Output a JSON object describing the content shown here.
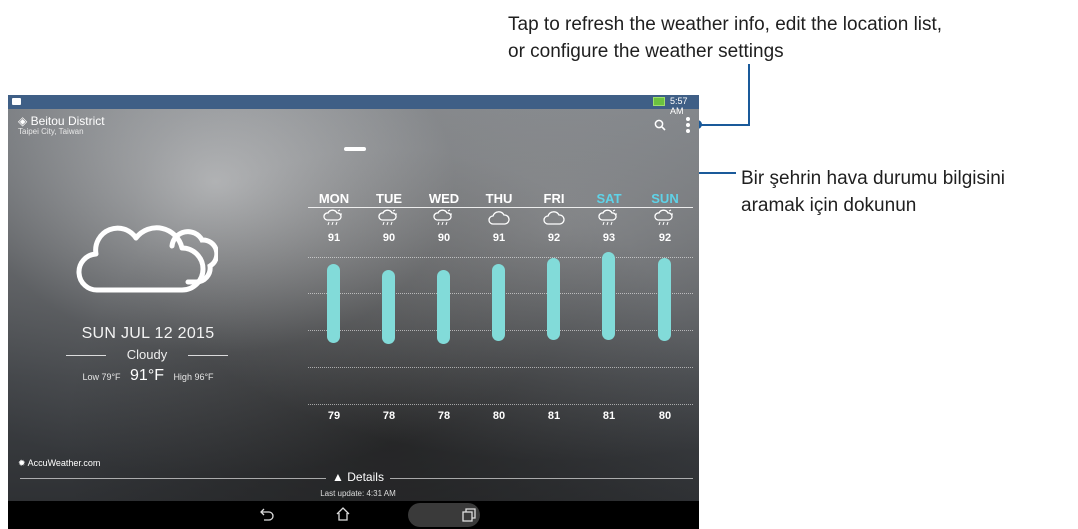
{
  "callouts": {
    "top_line1": "Tap to refresh the weather info, edit the location list,",
    "top_line2": "or configure the weather settings",
    "right_line1": "Bir şehrin hava durumu bilgisini",
    "right_line2": "aramak için dokunun"
  },
  "status_bar": {
    "time": "5:57 AM",
    "battery_icon": "battery-charging-icon"
  },
  "location": {
    "name": "Beitou District",
    "sub": "Taipei City, Taiwan",
    "icon": "location-icon"
  },
  "toolbar": {
    "search_icon": "search-icon",
    "menu_icon": "more-vert-icon"
  },
  "current": {
    "date": "SUN JUL 12 2015",
    "condition": "Cloudy",
    "low": "Low 79°F",
    "temp": "91°F",
    "high": "High 96°F",
    "icon": "cloud-icon"
  },
  "forecast": [
    {
      "day": "MON",
      "high": "91",
      "low": "79",
      "icon": "thunderstorm-icon",
      "weekend": false
    },
    {
      "day": "TUE",
      "high": "90",
      "low": "78",
      "icon": "thunderstorm-icon",
      "weekend": false
    },
    {
      "day": "WED",
      "high": "90",
      "low": "78",
      "icon": "thunderstorm-icon",
      "weekend": false
    },
    {
      "day": "THU",
      "high": "91",
      "low": "80",
      "icon": "cloud-icon",
      "weekend": false
    },
    {
      "day": "FRI",
      "high": "92",
      "low": "81",
      "icon": "cloud-icon",
      "weekend": false
    },
    {
      "day": "SAT",
      "high": "93",
      "low": "81",
      "icon": "thunderstorm-icon",
      "weekend": true
    },
    {
      "day": "SUN",
      "high": "92",
      "low": "80",
      "icon": "thunderstorm-icon",
      "weekend": true
    }
  ],
  "provider": "AccuWeather.com",
  "details_label": "▲ Details",
  "last_update": "Last update: 4:31 AM",
  "nav": {
    "back": "back-icon",
    "home": "home-icon",
    "recent": "recent-apps-icon"
  },
  "colors": {
    "accent_bar": "#82dbd9",
    "weekend": "#5fd3e8",
    "callout": "#1a5a9a"
  }
}
